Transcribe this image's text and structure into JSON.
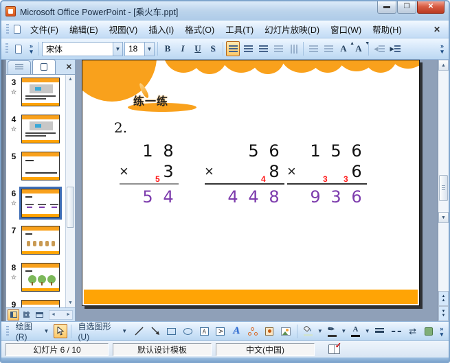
{
  "window": {
    "title": "Microsoft Office PowerPoint - [乘火车.ppt]"
  },
  "menubar": {
    "items": [
      "文件(F)",
      "编辑(E)",
      "视图(V)",
      "插入(I)",
      "格式(O)",
      "工具(T)",
      "幻灯片放映(D)",
      "窗口(W)",
      "帮助(H)"
    ],
    "close_label": "✕"
  },
  "format_toolbar": {
    "font_name": "宋体",
    "font_size": "18",
    "bold": "B",
    "italic": "I",
    "underline": "U",
    "shadow": "S"
  },
  "sidebar": {
    "slides": [
      {
        "number": "3",
        "starred": true,
        "selected": false,
        "art": "scene"
      },
      {
        "number": "4",
        "starred": true,
        "selected": false,
        "art": "scene"
      },
      {
        "number": "5",
        "starred": false,
        "selected": false,
        "art": "lines"
      },
      {
        "number": "6",
        "starred": true,
        "selected": true,
        "art": "math"
      },
      {
        "number": "7",
        "starred": false,
        "selected": false,
        "art": "figures"
      },
      {
        "number": "8",
        "starred": true,
        "selected": false,
        "art": "trees"
      },
      {
        "number": "9",
        "starred": false,
        "selected": false,
        "art": "photo"
      }
    ]
  },
  "slide": {
    "badge_label": "练一练",
    "item_number": "2.",
    "problems": [
      {
        "multiplicand": "18",
        "multiplier": "3",
        "product": "54",
        "carries": [
          {
            "col": 1,
            "digit": "5"
          }
        ]
      },
      {
        "multiplicand": "56",
        "multiplier": "8",
        "product": "448",
        "carries": [
          {
            "col": 2,
            "digit": "4"
          }
        ]
      },
      {
        "multiplicand": "156",
        "multiplier": "6",
        "product": "936",
        "carries": [
          {
            "col": 1,
            "digit": "3"
          },
          {
            "col": 2,
            "digit": "3"
          }
        ]
      }
    ],
    "colors": {
      "cloud_orange": "#f9a11c",
      "bottom_bar_orange": "#ffa405",
      "product_purple": "#7d3cad",
      "carry_red": "#ff1a1a"
    }
  },
  "drawing_toolbar": {
    "draw_label": "绘图(R)",
    "autoshapes_label": "自选图形(U)"
  },
  "statusbar": {
    "slide_info": "幻灯片 6 / 10",
    "template_name": "默认设计模板",
    "language": "中文(中国)"
  }
}
